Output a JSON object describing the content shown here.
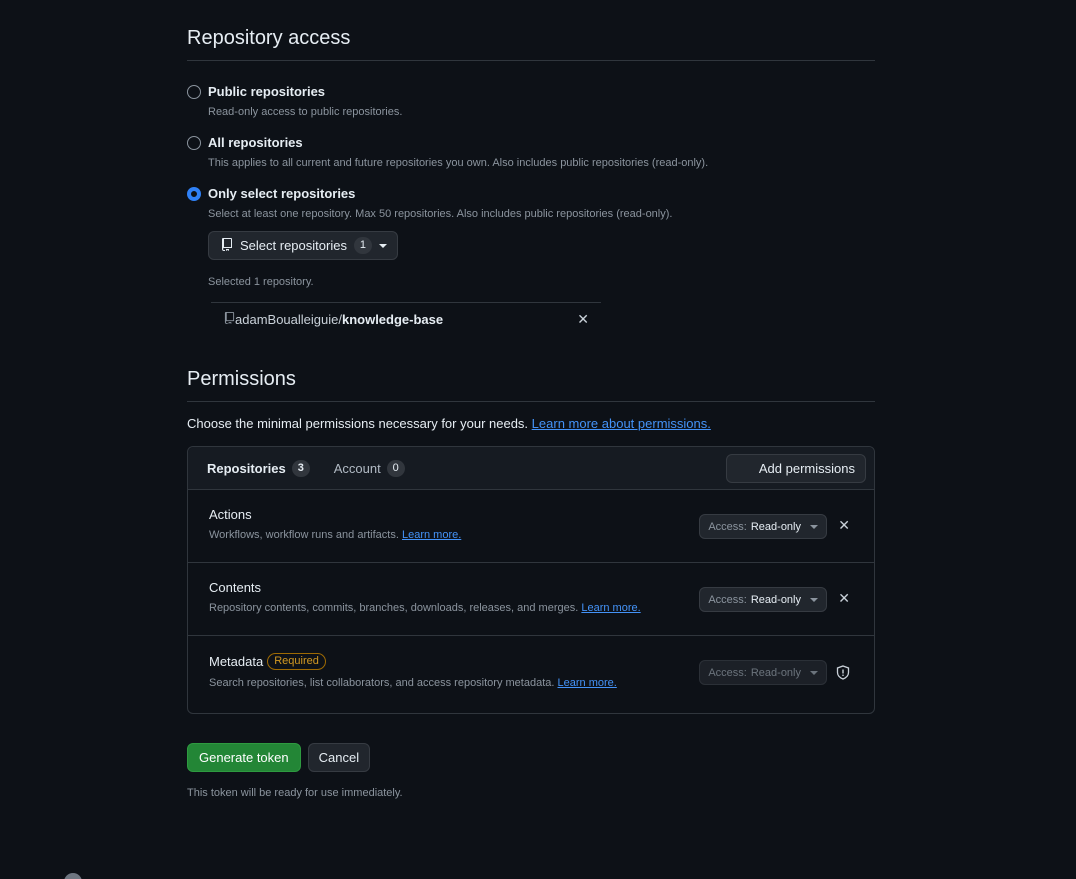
{
  "repository_access": {
    "title": "Repository access",
    "options": [
      {
        "label": "Public repositories",
        "description": "Read-only access to public repositories.",
        "checked": false
      },
      {
        "label": "All repositories",
        "description": "This applies to all current and future repositories you own. Also includes public repositories (read-only).",
        "checked": false
      },
      {
        "label": "Only select repositories",
        "description": "Select at least one repository. Max 50 repositories. Also includes public repositories (read-only).",
        "checked": true
      }
    ],
    "select_button": {
      "label": "Select repositories",
      "count": "1"
    },
    "selected_count_text": "Selected 1 repository.",
    "selected_repos": [
      {
        "owner": "adamBoualleiguie/",
        "name": "knowledge-base"
      }
    ]
  },
  "permissions": {
    "title": "Permissions",
    "intro_text": "Choose the minimal permissions necessary for your needs.",
    "intro_link": "Learn more about permissions.",
    "tabs": [
      {
        "label": "Repositories",
        "count": "3"
      },
      {
        "label": "Account",
        "count": "0"
      }
    ],
    "add_button": "Add permissions",
    "rows": [
      {
        "title": "Actions",
        "description": "Workflows, workflow runs and artifacts.",
        "link": "Learn more.",
        "access_label": "Access:",
        "access_value": "Read-only"
      },
      {
        "title": "Contents",
        "description": "Repository contents, commits, branches, downloads, releases, and merges.",
        "link": "Learn more.",
        "access_label": "Access:",
        "access_value": "Read-only"
      },
      {
        "title": "Metadata",
        "badge": "Required",
        "description": "Search repositories, list collaborators, and access repository metadata.",
        "link": "Learn more.",
        "access_label": "Access:",
        "access_value": "Read-only"
      }
    ]
  },
  "actions": {
    "generate_label": "Generate token",
    "cancel_label": "Cancel",
    "note": "This token will be ready for use immediately."
  },
  "colors": {
    "background": "#0d1117",
    "accent_blue": "#2f81f7",
    "link": "#4493f8",
    "primary_green": "#238636",
    "required_badge": "#d29922"
  },
  "icons": {
    "repo": "repo-icon",
    "close": "close-icon",
    "shield": "shield-icon",
    "caret": "caret-down-icon"
  }
}
